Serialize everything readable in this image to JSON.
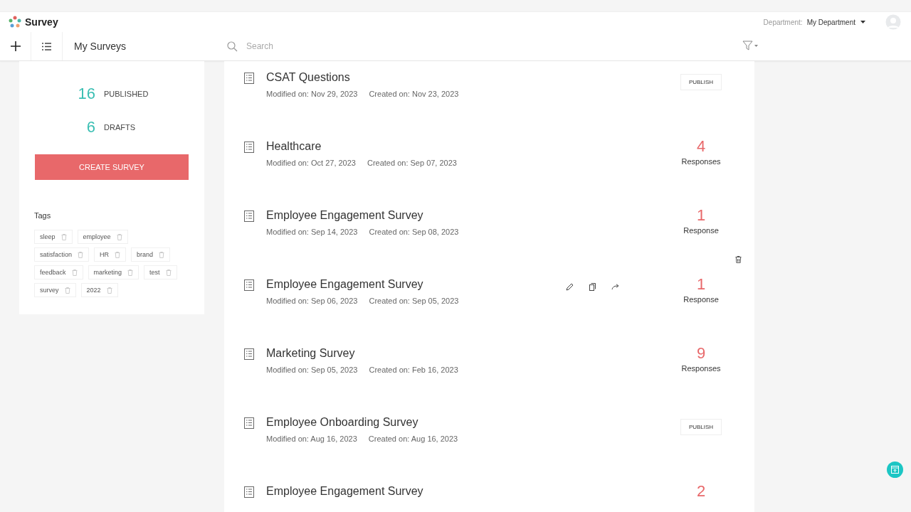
{
  "app": {
    "name": "Survey"
  },
  "department": {
    "label": "Department:",
    "value": "My Department"
  },
  "toolbar": {
    "title": "My Surveys",
    "search_placeholder": "Search"
  },
  "stats": [
    {
      "count": "16",
      "label": "PUBLISHED"
    },
    {
      "count": "6",
      "label": "DRAFTS"
    }
  ],
  "create_button": "CREATE SURVEY",
  "tags": {
    "title": "Tags",
    "items": [
      "sleep",
      "employee",
      "satisfaction",
      "HR",
      "brand",
      "feedback",
      "marketing",
      "test",
      "survey",
      "2022"
    ]
  },
  "surveys": [
    {
      "title": "CSAT Questions",
      "modified": "Modified on: Nov 29, 2023",
      "created": "Created on: Nov 23, 2023",
      "kind": "draft",
      "action": "PUBLISH",
      "hovered": false
    },
    {
      "title": "Healthcare",
      "modified": "Modified on: Oct 27, 2023",
      "created": "Created on: Sep 07, 2023",
      "kind": "published",
      "count": "4",
      "unit": "Responses",
      "hovered": false
    },
    {
      "title": "Employee Engagement Survey",
      "modified": "Modified on: Sep 14, 2023",
      "created": "Created on: Sep 08, 2023",
      "kind": "published",
      "count": "1",
      "unit": "Response",
      "hovered": false
    },
    {
      "title": "Employee Engagement Survey",
      "modified": "Modified on: Sep 06, 2023",
      "created": "Created on: Sep 05, 2023",
      "kind": "published",
      "count": "1",
      "unit": "Response",
      "hovered": true
    },
    {
      "title": "Marketing Survey",
      "modified": "Modified on: Sep 05, 2023",
      "created": "Created on: Feb 16, 2023",
      "kind": "published",
      "count": "9",
      "unit": "Responses",
      "hovered": false
    },
    {
      "title": "Employee Onboarding Survey",
      "modified": "Modified on: Aug 16, 2023",
      "created": "Created on: Aug 16, 2023",
      "kind": "draft",
      "action": "PUBLISH",
      "hovered": false
    },
    {
      "title": "Employee Engagement Survey",
      "kind": "partial",
      "count": "2",
      "hovered": false
    }
  ]
}
